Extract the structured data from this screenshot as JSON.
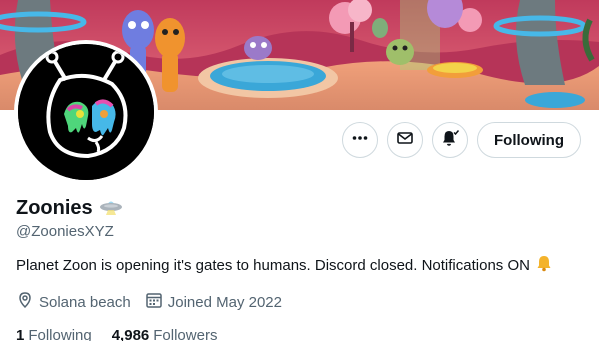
{
  "profile": {
    "display_name": "Zoonies",
    "handle": "@ZooniesXYZ",
    "bio": "Planet Zoon is opening it's gates to humans. Discord closed. Notifications ON",
    "location": "Solana beach",
    "joined": "Joined May 2022"
  },
  "stats": {
    "following_count": "1",
    "following_label": "Following",
    "followers_count": "4,986",
    "followers_label": "Followers"
  },
  "actions": {
    "follow_label": "Following"
  },
  "icons": {
    "name_badge": "ufo-emoji-icon",
    "bio_emoji": "bell-emoji-icon",
    "more": "more-dots-icon",
    "message": "envelope-icon",
    "notify": "bell-check-icon",
    "location": "location-pin-icon",
    "joined": "calendar-icon"
  },
  "colors": {
    "text_primary": "#0f1419",
    "text_secondary": "#536471",
    "border": "#cfd9de",
    "banner_sky": "#d8416a",
    "banner_pool": "#3aa7d8"
  }
}
